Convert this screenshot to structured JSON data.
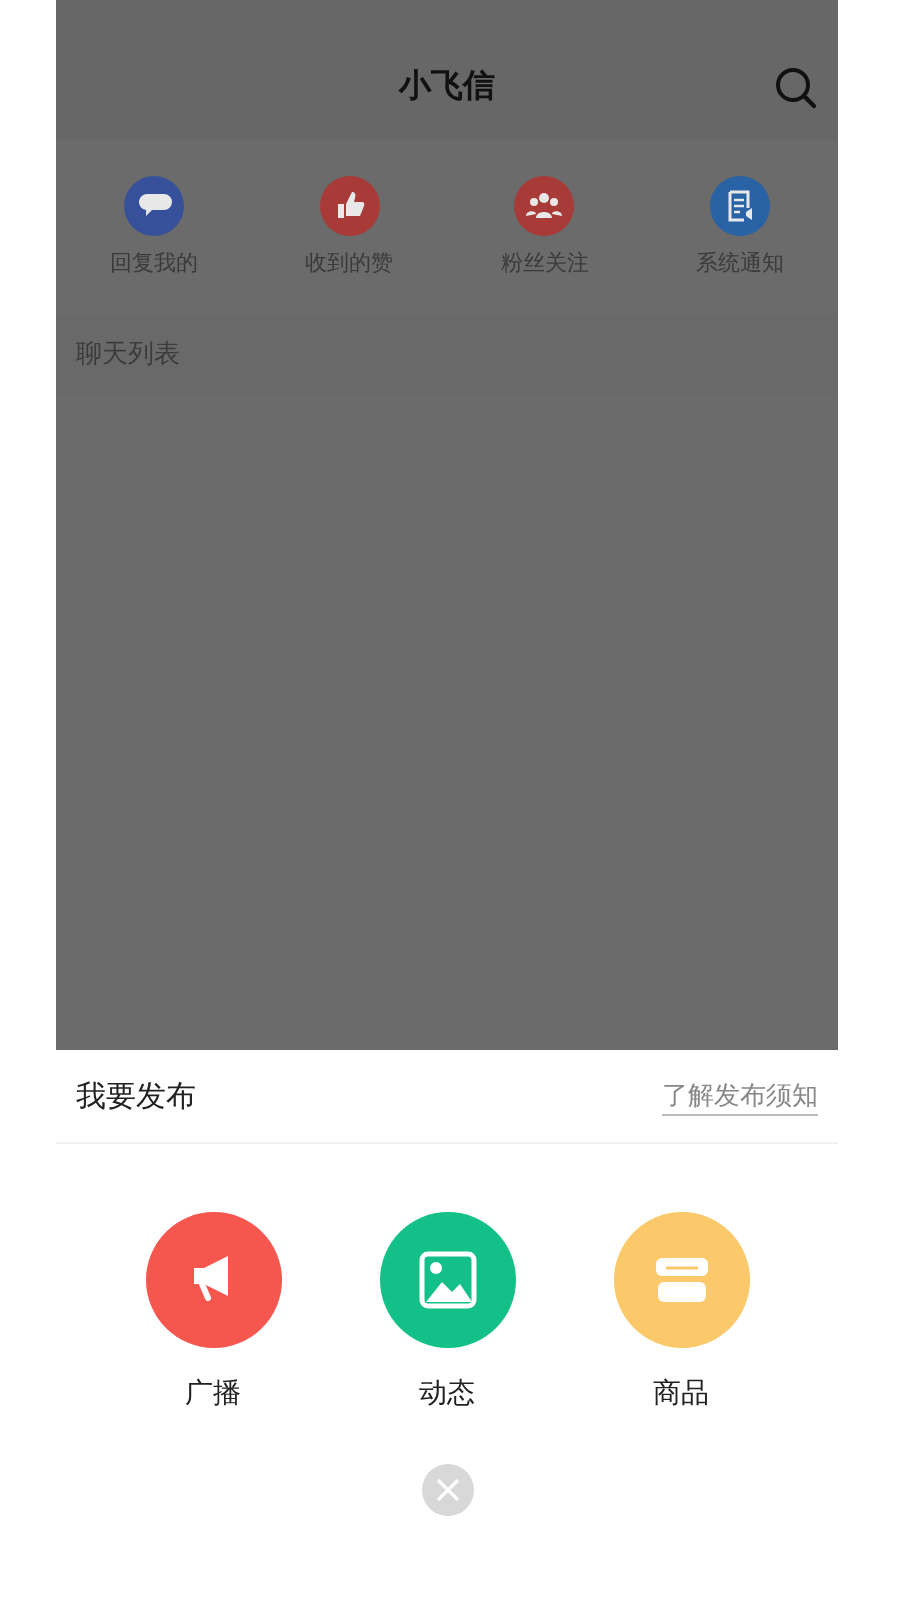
{
  "header": {
    "title": "小飞信"
  },
  "shortcuts": [
    {
      "label": "回复我的",
      "kind": "chat",
      "color": "#37509a"
    },
    {
      "label": "收到的赞",
      "kind": "thumb",
      "color": "#a83a38"
    },
    {
      "label": "粉丝关注",
      "kind": "people",
      "color": "#a83a38"
    },
    {
      "label": "系统通知",
      "kind": "notice",
      "color": "#2a62a6"
    }
  ],
  "section": {
    "label": "聊天列表"
  },
  "sheet": {
    "title": "我要发布",
    "link": "了解发布须知",
    "options": [
      {
        "label": "广播",
        "kind": "megaphone",
        "color": "#f5564e"
      },
      {
        "label": "动态",
        "kind": "image",
        "color": "#12c088"
      },
      {
        "label": "商品",
        "kind": "store",
        "color": "#fbc86a"
      }
    ]
  }
}
